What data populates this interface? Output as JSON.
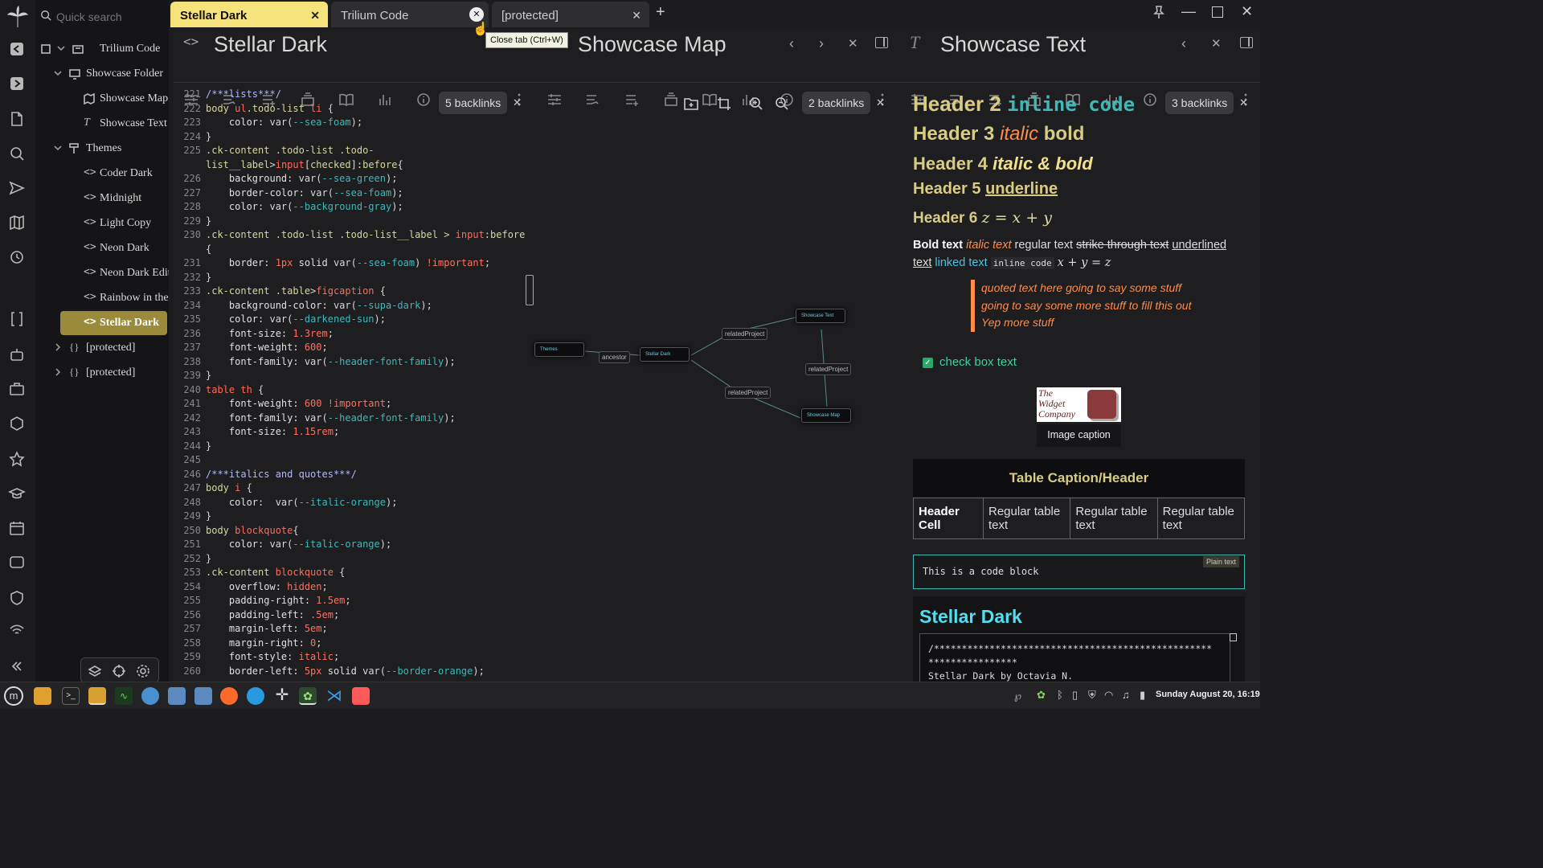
{
  "search": {
    "placeholder": "Quick search"
  },
  "tree": {
    "items": [
      {
        "label": "Trilium Code"
      },
      {
        "label": "Showcase Folder"
      },
      {
        "label": "Showcase Map"
      },
      {
        "label": "Showcase Text"
      },
      {
        "label": "Themes"
      },
      {
        "label": "Coder Dark"
      },
      {
        "label": "Midnight"
      },
      {
        "label": "Light Copy"
      },
      {
        "label": "Neon Dark"
      },
      {
        "label": "Neon Dark Edit"
      },
      {
        "label": "Rainbow in the"
      },
      {
        "label": "Stellar Dark"
      },
      {
        "label": "[protected]"
      },
      {
        "label": "[protected]"
      }
    ]
  },
  "tabs": [
    {
      "label": "Stellar Dark"
    },
    {
      "label": "Trilium Code"
    },
    {
      "label": "[protected]"
    }
  ],
  "tooltip": "Close tab (Ctrl+W)",
  "pane1": {
    "title": "Stellar Dark",
    "backlinks": "5 backlinks"
  },
  "pane2": {
    "title": "Showcase Map",
    "backlinks": "2 backlinks",
    "nodes": {
      "themes": "Themes",
      "stellar": "Stellar Dark",
      "text": "Showcase Text",
      "map": "Showcase Map"
    },
    "labels": {
      "ancestor": "ancestor",
      "rp1": "relatedProject",
      "rp2": "relatedProject",
      "rp3": "relatedProject"
    }
  },
  "pane3": {
    "title": "Showcase Text",
    "backlinks": "3 backlinks",
    "h2a": "Header 2 ",
    "h2b": "inline code",
    "h3a": "Header 3 ",
    "h3b": "italic",
    "h3c": " bold",
    "h4a": "Header 4 ",
    "h4b": "italic & bold",
    "h5a": "Header 5 ",
    "h5b": "underline",
    "h6a": "Header 6 ",
    "h6b": "z = x + y",
    "p_bold": "Bold text",
    "p_italic": "italic text",
    "p_reg": "regular text",
    "p_strike": "strike through text",
    "p_under": "underlined text",
    "p_link": "linked text",
    "p_code": "inline code",
    "p_math": "x + y = z",
    "quote": [
      "quoted text here going to say some stuff",
      "going to say some more stuff to fill this out",
      "Yep more stuff"
    ],
    "check": "check box text",
    "logo": [
      "The",
      "Widget",
      "Company"
    ],
    "caption": "Image caption",
    "table_caption": "Table Caption/Header",
    "table": {
      "header_cell": "Header Cell",
      "cells": [
        "Regular table text",
        "Regular table text",
        "Regular table text"
      ]
    },
    "code_lang": "Plain text",
    "code_block": "This is a code block",
    "include_title": "Stellar Dark",
    "include_lines": [
      "/**************************************************",
      "****************",
      "Stellar Dark by Octavia N."
    ]
  },
  "code": [
    {
      "n": "221",
      "parts": [
        [
          "c-com",
          "/***lists***/"
        ]
      ]
    },
    {
      "n": "222",
      "parts": [
        [
          "c-sel",
          "body "
        ],
        [
          "c-tag",
          "ul"
        ],
        [
          "c-sel",
          ".todo-list "
        ],
        [
          "c-tag",
          "li"
        ],
        [
          "c-txt",
          " {"
        ]
      ]
    },
    {
      "n": "223",
      "parts": [
        [
          "c-prop",
          "    color: "
        ],
        [
          "c-txt",
          "var("
        ],
        [
          "c-var",
          "--sea-foam"
        ],
        [
          "c-txt",
          ");"
        ]
      ]
    },
    {
      "n": "224",
      "parts": [
        [
          "c-txt",
          "}"
        ]
      ]
    },
    {
      "n": "225",
      "parts": [
        [
          "c-sel",
          ".ck-content .todo-list .todo-"
        ]
      ]
    },
    {
      "n": "",
      "parts": [
        [
          "c-sel",
          "list__label"
        ],
        [
          "c-txt",
          ">"
        ],
        [
          "c-tag",
          "input"
        ],
        [
          "c-txt",
          "["
        ],
        [
          "c-sel",
          "checked"
        ],
        [
          "c-txt",
          "]:"
        ],
        [
          "c-sel",
          "before"
        ],
        [
          "c-txt",
          "{"
        ]
      ]
    },
    {
      "n": "226",
      "parts": [
        [
          "c-prop",
          "    background: "
        ],
        [
          "c-txt",
          "var("
        ],
        [
          "c-var",
          "--sea-green"
        ],
        [
          "c-txt",
          ");"
        ]
      ]
    },
    {
      "n": "227",
      "parts": [
        [
          "c-prop",
          "    border-color: "
        ],
        [
          "c-txt",
          "var("
        ],
        [
          "c-var",
          "--sea-foam"
        ],
        [
          "c-txt",
          ");"
        ]
      ]
    },
    {
      "n": "228",
      "parts": [
        [
          "c-prop",
          "    color: "
        ],
        [
          "c-txt",
          "var("
        ],
        [
          "c-var",
          "--background-gray"
        ],
        [
          "c-txt",
          ");"
        ]
      ]
    },
    {
      "n": "229",
      "parts": [
        [
          "c-txt",
          "}"
        ]
      ]
    },
    {
      "n": "230",
      "parts": [
        [
          "c-sel",
          ".ck-content .todo-list .todo-list__label > "
        ],
        [
          "c-tag",
          "input"
        ],
        [
          "c-txt",
          ":"
        ],
        [
          "c-sel",
          "before"
        ]
      ]
    },
    {
      "n": "",
      "parts": [
        [
          "c-txt",
          "{"
        ]
      ]
    },
    {
      "n": "231",
      "parts": [
        [
          "c-prop",
          "    border: "
        ],
        [
          "c-num",
          "1px"
        ],
        [
          "c-prop",
          " solid "
        ],
        [
          "c-txt",
          "var("
        ],
        [
          "c-var",
          "--sea-foam"
        ],
        [
          "c-txt",
          ") "
        ],
        [
          "c-num",
          "!important"
        ],
        [
          "c-txt",
          ";"
        ]
      ]
    },
    {
      "n": "232",
      "parts": [
        [
          "c-txt",
          "}"
        ]
      ]
    },
    {
      "n": "233",
      "parts": [
        [
          "c-sel",
          ".ck-content .table"
        ],
        [
          "c-txt",
          ">"
        ],
        [
          "c-tag",
          "figcaption"
        ],
        [
          "c-txt",
          " {"
        ]
      ]
    },
    {
      "n": "234",
      "parts": [
        [
          "c-prop",
          "    background-color: "
        ],
        [
          "c-txt",
          "var("
        ],
        [
          "c-var",
          "--supa-dark"
        ],
        [
          "c-txt",
          ");"
        ]
      ]
    },
    {
      "n": "235",
      "parts": [
        [
          "c-prop",
          "    color: "
        ],
        [
          "c-txt",
          "var("
        ],
        [
          "c-var",
          "--darkened-sun"
        ],
        [
          "c-txt",
          ");"
        ]
      ]
    },
    {
      "n": "236",
      "parts": [
        [
          "c-prop",
          "    font-size: "
        ],
        [
          "c-num",
          "1.3rem"
        ],
        [
          "c-txt",
          ";"
        ]
      ]
    },
    {
      "n": "237",
      "parts": [
        [
          "c-prop",
          "    font-weight: "
        ],
        [
          "c-num",
          "600"
        ],
        [
          "c-txt",
          ";"
        ]
      ]
    },
    {
      "n": "238",
      "parts": [
        [
          "c-prop",
          "    font-family: "
        ],
        [
          "c-txt",
          "var("
        ],
        [
          "c-var",
          "--header-font-family"
        ],
        [
          "c-txt",
          ");"
        ]
      ]
    },
    {
      "n": "239",
      "parts": [
        [
          "c-txt",
          "}"
        ]
      ]
    },
    {
      "n": "240",
      "parts": [
        [
          "c-tag",
          "table th"
        ],
        [
          "c-txt",
          " {"
        ]
      ]
    },
    {
      "n": "241",
      "parts": [
        [
          "c-prop",
          "    font-weight: "
        ],
        [
          "c-num",
          "600 !important"
        ],
        [
          "c-txt",
          ";"
        ]
      ]
    },
    {
      "n": "242",
      "parts": [
        [
          "c-prop",
          "    font-family: "
        ],
        [
          "c-txt",
          "var("
        ],
        [
          "c-var",
          "--header-font-family"
        ],
        [
          "c-txt",
          ");"
        ]
      ]
    },
    {
      "n": "243",
      "parts": [
        [
          "c-prop",
          "    font-size: "
        ],
        [
          "c-num",
          "1.15rem"
        ],
        [
          "c-txt",
          ";"
        ]
      ]
    },
    {
      "n": "244",
      "parts": [
        [
          "c-txt",
          "}"
        ]
      ]
    },
    {
      "n": "245",
      "parts": [
        [
          "c-txt",
          ""
        ]
      ]
    },
    {
      "n": "246",
      "parts": [
        [
          "c-com",
          "/***italics and quotes***/"
        ]
      ]
    },
    {
      "n": "247",
      "parts": [
        [
          "c-sel",
          "body "
        ],
        [
          "c-tag",
          "i"
        ],
        [
          "c-txt",
          " {"
        ]
      ]
    },
    {
      "n": "248",
      "parts": [
        [
          "c-prop",
          "    color:  "
        ],
        [
          "c-txt",
          "var("
        ],
        [
          "c-var",
          "--italic-orange"
        ],
        [
          "c-txt",
          ");"
        ]
      ]
    },
    {
      "n": "249",
      "parts": [
        [
          "c-txt",
          "}"
        ]
      ]
    },
    {
      "n": "250",
      "parts": [
        [
          "c-sel",
          "body "
        ],
        [
          "c-tag",
          "blockquote"
        ],
        [
          "c-txt",
          "{"
        ]
      ]
    },
    {
      "n": "251",
      "parts": [
        [
          "c-prop",
          "    color: "
        ],
        [
          "c-txt",
          "var("
        ],
        [
          "c-var",
          "--italic-orange"
        ],
        [
          "c-txt",
          ");"
        ]
      ]
    },
    {
      "n": "252",
      "parts": [
        [
          "c-txt",
          "}"
        ]
      ]
    },
    {
      "n": "253",
      "parts": [
        [
          "c-sel",
          ".ck-content "
        ],
        [
          "c-tag",
          "blockquote"
        ],
        [
          "c-txt",
          " {"
        ]
      ]
    },
    {
      "n": "254",
      "parts": [
        [
          "c-prop",
          "    overflow: "
        ],
        [
          "c-num",
          "hidden"
        ],
        [
          "c-txt",
          ";"
        ]
      ]
    },
    {
      "n": "255",
      "parts": [
        [
          "c-prop",
          "    padding-right: "
        ],
        [
          "c-num",
          "1.5em"
        ],
        [
          "c-txt",
          ";"
        ]
      ]
    },
    {
      "n": "256",
      "parts": [
        [
          "c-prop",
          "    padding-left: "
        ],
        [
          "c-num",
          ".5em"
        ],
        [
          "c-txt",
          ";"
        ]
      ]
    },
    {
      "n": "257",
      "parts": [
        [
          "c-prop",
          "    margin-left: "
        ],
        [
          "c-num",
          "5em"
        ],
        [
          "c-txt",
          ";"
        ]
      ]
    },
    {
      "n": "258",
      "parts": [
        [
          "c-prop",
          "    margin-right: "
        ],
        [
          "c-num",
          "0"
        ],
        [
          "c-txt",
          ";"
        ]
      ]
    },
    {
      "n": "259",
      "parts": [
        [
          "c-prop",
          "    font-style: "
        ],
        [
          "c-num",
          "italic"
        ],
        [
          "c-txt",
          ";"
        ]
      ]
    },
    {
      "n": "260",
      "parts": [
        [
          "c-prop",
          "    border-left: "
        ],
        [
          "c-num",
          "5px"
        ],
        [
          "c-prop",
          " solid "
        ],
        [
          "c-txt",
          "var("
        ],
        [
          "c-var",
          "--border-orange"
        ],
        [
          "c-txt",
          ");"
        ]
      ]
    }
  ],
  "clock": "Sunday August 20, 16:19",
  "colors": {
    "accent": "#d8cc84",
    "active_tab": "#f6e27a",
    "teal": "#3fb8b8",
    "orange": "#ff8c4a"
  }
}
